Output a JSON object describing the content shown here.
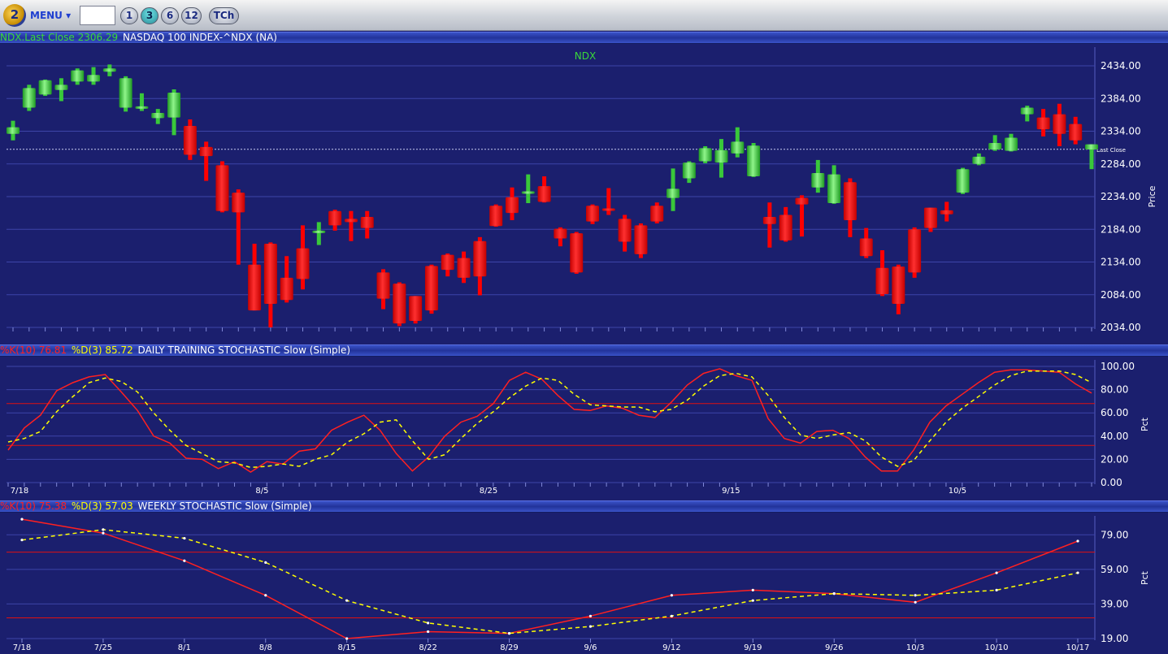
{
  "toolbar": {
    "logo_text": "2",
    "menu_label": "MENU ▾",
    "symbol_value": "",
    "period_buttons": [
      "1",
      "3",
      "6",
      "12"
    ],
    "active_period": "3",
    "tch_label": "TCh"
  },
  "price_panel": {
    "title_symbol": "NDX.Last Close 2306.29",
    "title_name": "NASDAQ 100 INDEX-^NDX (NA)",
    "chart_title": "NDX",
    "ylabel": "Price",
    "last_close_label": "Last Close",
    "colors": {
      "up": "#39c83a",
      "down": "#ff0000",
      "text_green": "#3ad83a"
    }
  },
  "daily_panel": {
    "title_k": "%K(10) 76.81",
    "title_d": "%D(3) 85.72",
    "title_name": "DAILY TRAINING STOCHASTIC Slow (Simple)",
    "ylabel": "Pct",
    "colors": {
      "k": "#ff2020",
      "d": "#ffff00"
    }
  },
  "weekly_panel": {
    "title_k": "%K(10) 75.38",
    "title_d": "%D(3) 57.03",
    "title_name": "WEEKLY STOCHASTIC Slow (Simple)",
    "ylabel": "Pct",
    "colors": {
      "k": "#ff2020",
      "d": "#ffff00"
    }
  },
  "chart_data": [
    {
      "type": "candlestick",
      "title": "NDX",
      "ylabel": "Price",
      "ylim": [
        2034,
        2434
      ],
      "yticks": [
        "2434.00",
        "2384.00",
        "2334.00",
        "2284.00",
        "2234.00",
        "2184.00",
        "2134.00",
        "2084.00",
        "2034.00"
      ],
      "last_close": 2306.29,
      "candles": [
        {
          "o": 2330,
          "h": 2350,
          "l": 2320,
          "c": 2340
        },
        {
          "o": 2370,
          "h": 2405,
          "l": 2365,
          "c": 2400
        },
        {
          "o": 2390,
          "h": 2413,
          "l": 2388,
          "c": 2412
        },
        {
          "o": 2397,
          "h": 2415,
          "l": 2380,
          "c": 2405
        },
        {
          "o": 2410,
          "h": 2430,
          "l": 2405,
          "c": 2427
        },
        {
          "o": 2410,
          "h": 2432,
          "l": 2405,
          "c": 2420
        },
        {
          "o": 2425,
          "h": 2436,
          "l": 2418,
          "c": 2430
        },
        {
          "o": 2370,
          "h": 2418,
          "l": 2364,
          "c": 2415
        },
        {
          "o": 2370,
          "h": 2392,
          "l": 2365,
          "c": 2372
        },
        {
          "o": 2354,
          "h": 2368,
          "l": 2345,
          "c": 2362
        },
        {
          "o": 2355,
          "h": 2398,
          "l": 2328,
          "c": 2393
        },
        {
          "o": 2342,
          "h": 2352,
          "l": 2290,
          "c": 2298
        },
        {
          "o": 2310,
          "h": 2318,
          "l": 2258,
          "c": 2296
        },
        {
          "o": 2282,
          "h": 2288,
          "l": 2210,
          "c": 2212
        },
        {
          "o": 2240,
          "h": 2245,
          "l": 2130,
          "c": 2210
        },
        {
          "o": 2130,
          "h": 2162,
          "l": 2060,
          "c": 2060
        },
        {
          "o": 2162,
          "h": 2164,
          "l": 2034,
          "c": 2070
        },
        {
          "o": 2110,
          "h": 2143,
          "l": 2072,
          "c": 2076
        },
        {
          "o": 2155,
          "h": 2190,
          "l": 2092,
          "c": 2108
        },
        {
          "o": 2182,
          "h": 2195,
          "l": 2160,
          "c": 2182
        },
        {
          "o": 2212,
          "h": 2214,
          "l": 2182,
          "c": 2190
        },
        {
          "o": 2200,
          "h": 2212,
          "l": 2166,
          "c": 2195
        },
        {
          "o": 2203,
          "h": 2212,
          "l": 2170,
          "c": 2186
        },
        {
          "o": 2118,
          "h": 2123,
          "l": 2062,
          "c": 2078
        },
        {
          "o": 2101,
          "h": 2103,
          "l": 2036,
          "c": 2040
        },
        {
          "o": 2082,
          "h": 2082,
          "l": 2040,
          "c": 2044
        },
        {
          "o": 2128,
          "h": 2130,
          "l": 2055,
          "c": 2060
        },
        {
          "o": 2145,
          "h": 2147,
          "l": 2112,
          "c": 2122
        },
        {
          "o": 2140,
          "h": 2150,
          "l": 2102,
          "c": 2110
        },
        {
          "o": 2166,
          "h": 2172,
          "l": 2083,
          "c": 2112
        },
        {
          "o": 2220,
          "h": 2222,
          "l": 2188,
          "c": 2189
        },
        {
          "o": 2233,
          "h": 2248,
          "l": 2198,
          "c": 2209
        },
        {
          "o": 2242,
          "h": 2268,
          "l": 2224,
          "c": 2242
        },
        {
          "o": 2250,
          "h": 2265,
          "l": 2225,
          "c": 2226
        },
        {
          "o": 2185,
          "h": 2187,
          "l": 2158,
          "c": 2170
        },
        {
          "o": 2178,
          "h": 2180,
          "l": 2116,
          "c": 2118
        },
        {
          "o": 2220,
          "h": 2222,
          "l": 2192,
          "c": 2196
        },
        {
          "o": 2216,
          "h": 2247,
          "l": 2206,
          "c": 2213
        },
        {
          "o": 2200,
          "h": 2206,
          "l": 2150,
          "c": 2165
        },
        {
          "o": 2190,
          "h": 2193,
          "l": 2140,
          "c": 2146
        },
        {
          "o": 2220,
          "h": 2225,
          "l": 2193,
          "c": 2196
        },
        {
          "o": 2232,
          "h": 2277,
          "l": 2212,
          "c": 2246
        },
        {
          "o": 2262,
          "h": 2288,
          "l": 2255,
          "c": 2286
        },
        {
          "o": 2288,
          "h": 2311,
          "l": 2285,
          "c": 2308
        },
        {
          "o": 2286,
          "h": 2322,
          "l": 2263,
          "c": 2305
        },
        {
          "o": 2300,
          "h": 2340,
          "l": 2294,
          "c": 2318
        },
        {
          "o": 2265,
          "h": 2316,
          "l": 2264,
          "c": 2312
        },
        {
          "o": 2203,
          "h": 2225,
          "l": 2156,
          "c": 2192
        },
        {
          "o": 2206,
          "h": 2218,
          "l": 2165,
          "c": 2167
        },
        {
          "o": 2232,
          "h": 2236,
          "l": 2173,
          "c": 2222
        },
        {
          "o": 2248,
          "h": 2290,
          "l": 2240,
          "c": 2270
        },
        {
          "o": 2224,
          "h": 2282,
          "l": 2223,
          "c": 2268
        },
        {
          "o": 2256,
          "h": 2262,
          "l": 2172,
          "c": 2198
        },
        {
          "o": 2170,
          "h": 2186,
          "l": 2140,
          "c": 2143
        },
        {
          "o": 2125,
          "h": 2152,
          "l": 2082,
          "c": 2085
        },
        {
          "o": 2127,
          "h": 2130,
          "l": 2054,
          "c": 2070
        },
        {
          "o": 2184,
          "h": 2187,
          "l": 2110,
          "c": 2118
        },
        {
          "o": 2217,
          "h": 2217,
          "l": 2180,
          "c": 2186
        },
        {
          "o": 2213,
          "h": 2226,
          "l": 2196,
          "c": 2207
        },
        {
          "o": 2240,
          "h": 2278,
          "l": 2238,
          "c": 2276
        },
        {
          "o": 2284,
          "h": 2300,
          "l": 2282,
          "c": 2295
        },
        {
          "o": 2306,
          "h": 2328,
          "l": 2304,
          "c": 2316
        },
        {
          "o": 2304,
          "h": 2330,
          "l": 2303,
          "c": 2324
        },
        {
          "o": 2360,
          "h": 2373,
          "l": 2349,
          "c": 2370
        },
        {
          "o": 2355,
          "h": 2368,
          "l": 2326,
          "c": 2337
        },
        {
          "o": 2360,
          "h": 2376,
          "l": 2311,
          "c": 2330
        },
        {
          "o": 2345,
          "h": 2356,
          "l": 2314,
          "c": 2320
        },
        {
          "o": 2306,
          "h": 2314,
          "l": 2276,
          "c": 2314
        }
      ]
    },
    {
      "type": "line",
      "title": "DAILY TRAINING STOCHASTIC Slow (Simple)",
      "ylabel": "Pct",
      "ylim": [
        0,
        100
      ],
      "yticks": [
        "100.00",
        "80.00",
        "60.00",
        "40.00",
        "20.00",
        "0.00"
      ],
      "reference_lines": [
        68,
        32
      ],
      "x_tick_labels": [
        {
          "label": "7/18",
          "index": 0
        },
        {
          "label": "8/5",
          "index": 15
        },
        {
          "label": "8/25",
          "index": 29
        },
        {
          "label": "9/15",
          "index": 44
        },
        {
          "label": "10/5",
          "index": 58
        }
      ],
      "series": [
        {
          "name": "%K(10)",
          "style": "solid",
          "values": [
            28,
            47,
            58,
            79,
            86,
            91,
            93,
            78,
            62,
            40,
            34,
            21,
            20,
            12,
            18,
            9,
            18,
            16,
            27,
            29,
            45,
            52,
            58,
            45,
            25,
            10,
            22,
            40,
            52,
            57,
            68,
            88,
            95,
            89,
            75,
            63,
            62,
            66,
            64,
            58,
            56,
            69,
            84,
            94,
            98,
            92,
            88,
            55,
            38,
            34,
            44,
            45,
            38,
            22,
            10,
            10,
            28,
            52,
            66,
            76,
            86,
            95,
            97,
            97,
            96,
            95,
            85,
            77
          ]
        },
        {
          "name": "%D(3)",
          "style": "dashed",
          "values": [
            35,
            38,
            44,
            61,
            74,
            86,
            90,
            87,
            78,
            60,
            45,
            32,
            25,
            18,
            17,
            13,
            14,
            16,
            14,
            20,
            24,
            35,
            42,
            52,
            54,
            36,
            20,
            24,
            38,
            51,
            61,
            73,
            83,
            90,
            88,
            76,
            67,
            66,
            65,
            65,
            61,
            63,
            71,
            83,
            92,
            94,
            91,
            75,
            56,
            41,
            38,
            41,
            43,
            36,
            22,
            14,
            19,
            36,
            52,
            64,
            74,
            84,
            92,
            96,
            96,
            96,
            93,
            86
          ]
        }
      ]
    },
    {
      "type": "line",
      "title": "WEEKLY STOCHASTIC Slow (Simple)",
      "ylabel": "Pct",
      "ylim": [
        19,
        89
      ],
      "yticks": [
        "79.00",
        "59.00",
        "39.00",
        "19.00"
      ],
      "reference_lines": [
        69,
        31
      ],
      "categories": [
        "7/18",
        "7/25",
        "8/1",
        "8/8",
        "8/15",
        "8/22",
        "8/29",
        "9/6",
        "9/12",
        "9/19",
        "9/26",
        "10/3",
        "10/10",
        "10/17"
      ],
      "series": [
        {
          "name": "%K(10)",
          "style": "solid",
          "values": [
            88,
            80,
            64,
            44,
            19,
            23,
            22,
            32,
            44,
            47,
            45,
            40,
            57,
            75.38
          ]
        },
        {
          "name": "%D(3)",
          "style": "dashed",
          "values": [
            76,
            82,
            77,
            63,
            41,
            28,
            22,
            26,
            32,
            41,
            45,
            44,
            47,
            57.03
          ]
        }
      ]
    }
  ]
}
